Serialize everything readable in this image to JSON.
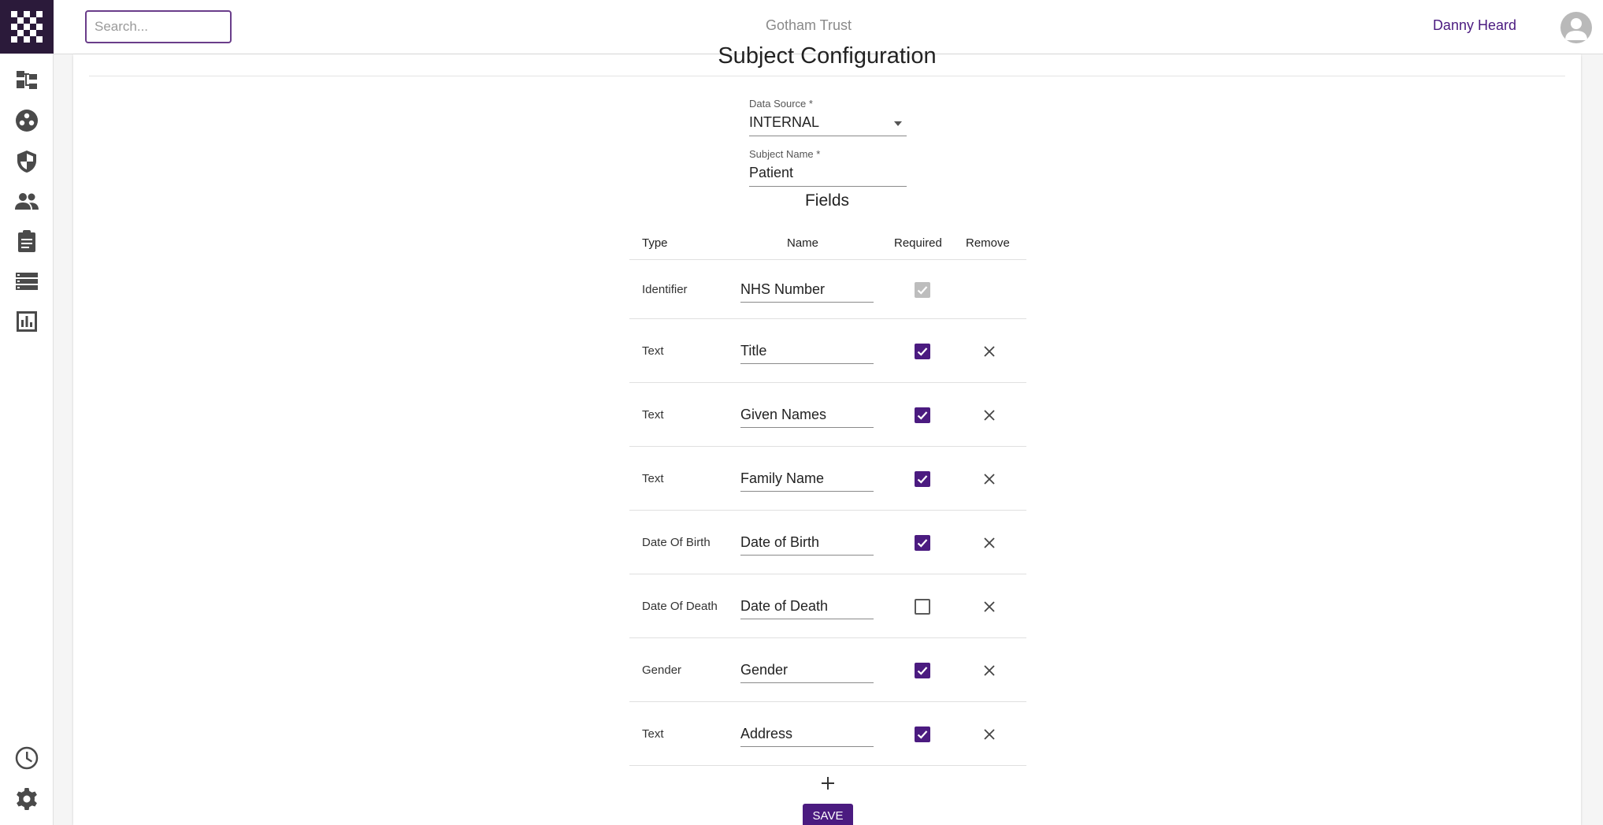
{
  "topbar": {
    "search_placeholder": "Search...",
    "organization": "Gotham Trust",
    "user_name": "Danny Heard"
  },
  "sidebar": {
    "items": [
      {
        "icon": "hierarchy-icon"
      },
      {
        "icon": "group-circle-icon"
      },
      {
        "icon": "shield-icon"
      },
      {
        "icon": "people-icon"
      },
      {
        "icon": "clipboard-icon"
      },
      {
        "icon": "storage-list-icon"
      },
      {
        "icon": "bar-chart-icon"
      }
    ],
    "bottom_items": [
      {
        "icon": "clock-icon"
      },
      {
        "icon": "gear-icon"
      }
    ]
  },
  "page": {
    "title": "Subject Configuration",
    "data_source": {
      "label": "Data Source *",
      "value": "INTERNAL"
    },
    "subject_name": {
      "label": "Subject Name *",
      "value": "Patient"
    },
    "fields_title": "Fields",
    "columns": {
      "type": "Type",
      "name": "Name",
      "required": "Required",
      "remove": "Remove"
    },
    "rows": [
      {
        "type": "Identifier",
        "name": "NHS Number",
        "required": true,
        "locked": true
      },
      {
        "type": "Text",
        "name": "Title",
        "required": true
      },
      {
        "type": "Text",
        "name": "Given Names",
        "required": true
      },
      {
        "type": "Text",
        "name": "Family Name",
        "required": true
      },
      {
        "type": "Date Of Birth",
        "name": "Date of Birth",
        "required": true
      },
      {
        "type": "Date Of Death",
        "name": "Date of Death",
        "required": false
      },
      {
        "type": "Gender",
        "name": "Gender",
        "required": true
      },
      {
        "type": "Text",
        "name": "Address",
        "required": true
      }
    ],
    "save_label": "SAVE"
  },
  "colors": {
    "accent": "#4b1b80",
    "logo_bg": "#2b1a3a",
    "org_text": "#8a8a8a"
  }
}
